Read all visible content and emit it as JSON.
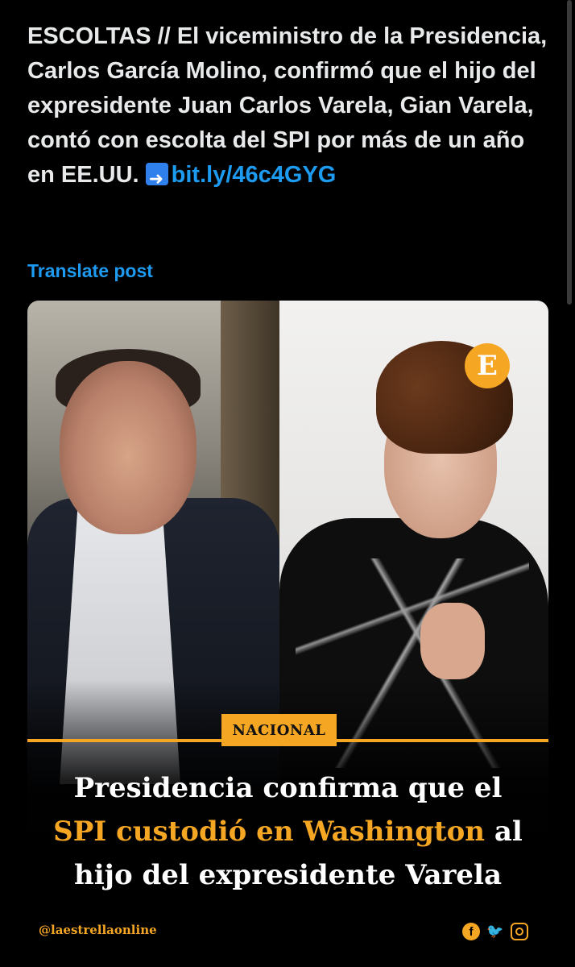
{
  "post": {
    "text_1": "ESCOLTAS // El viceministro de la Presidencia, Carlos García Molino, confirmó que el hijo del expresidente Juan Carlos Varela, Gian Varela, contó con escolta del SPI por más de un año en EE.UU. ",
    "link": "bit.ly/46c4GYG",
    "translate_label": "Translate post"
  },
  "card": {
    "logo_letter": "E",
    "section": "NACIONAL",
    "headline_1": "Presidencia confirma que el",
    "headline_highlight": "SPI custodió en Washington",
    "headline_2": " al",
    "headline_3": "hijo del expresidente Varela",
    "handle": "@laestrellaonline",
    "social_icons": [
      "facebook-icon",
      "twitter-icon",
      "instagram-icon"
    ],
    "accent_color": "#f5a623"
  }
}
